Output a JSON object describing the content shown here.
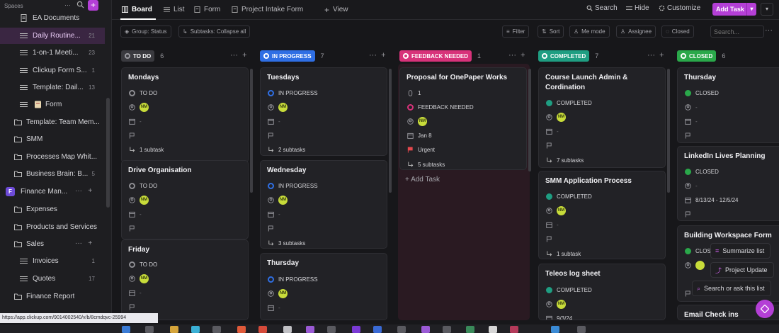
{
  "sidebar": {
    "section_label": "Spaces",
    "items": [
      {
        "label": "EA Documents",
        "count": ""
      },
      {
        "label": "Daily Routine...",
        "count": "21"
      },
      {
        "label": "1-on-1 Meeti...",
        "count": "23"
      },
      {
        "label": "Clickup Form S...",
        "count": "1"
      },
      {
        "label": "Template: Dail...",
        "count": "13"
      },
      {
        "label": "Form",
        "count": ""
      },
      {
        "label": "Template: Team Mem...",
        "count": ""
      },
      {
        "label": "SMM",
        "count": ""
      },
      {
        "label": "Processes Map Whit...",
        "count": ""
      },
      {
        "label": "Business Brain: B...",
        "count": "5"
      },
      {
        "label": "Finance Man...",
        "count": ""
      },
      {
        "label": "Expenses",
        "count": ""
      },
      {
        "label": "Products and Services",
        "count": ""
      },
      {
        "label": "Sales",
        "count": ""
      },
      {
        "label": "Invoices",
        "count": "1"
      },
      {
        "label": "Quotes",
        "count": "17"
      },
      {
        "label": "Finance Report",
        "count": ""
      }
    ],
    "finance_badge": "F"
  },
  "topbar": {
    "tabs": [
      "Board",
      "List",
      "Form",
      "Project Intake Form",
      "View"
    ],
    "search": "Search",
    "hide": "Hide",
    "customize": "Customize",
    "add_task": "Add Task"
  },
  "filterbar": {
    "group": "Group: Status",
    "subtasks": "Subtasks: Collapse all",
    "filter": "Filter",
    "sort": "Sort",
    "me_mode": "Me mode",
    "assignee": "Assignee",
    "closed": "Closed",
    "search_placeholder": "Search..."
  },
  "colors": {
    "todo": "#3a3a3f",
    "in_progress": "#2f6fe4",
    "feedback_needed": "#d8327a",
    "completed": "#1f9e82",
    "closed": "#2aa84a",
    "accent": "#b43fd6"
  },
  "columns": [
    {
      "status": "TO DO",
      "count": "6"
    },
    {
      "status": "IN PROGRESS",
      "count": "7"
    },
    {
      "status": "FEEDBACK NEEDED",
      "count": "1"
    },
    {
      "status": "COMPLETED",
      "count": "7"
    },
    {
      "status": "CLOSED",
      "count": "6"
    }
  ],
  "cards": {
    "todo": [
      {
        "title": "Mondays",
        "status": "TO DO",
        "assignee": "NM",
        "date": "-",
        "subtasks": "1 subtask"
      },
      {
        "title": "Drive Organisation",
        "status": "TO DO",
        "assignee": "NM",
        "date": "-"
      },
      {
        "title": "Friday",
        "status": "TO DO",
        "assignee": "NM",
        "date": "-"
      }
    ],
    "in_progress": [
      {
        "title": "Tuesdays",
        "status": "IN PROGRESS",
        "assignee": "NM",
        "date": "-",
        "subtasks": "2 subtasks"
      },
      {
        "title": "Wednesday",
        "status": "IN PROGRESS",
        "assignee": "NM",
        "date": "-",
        "subtasks": "3 subtasks"
      },
      {
        "title": "Thursday",
        "status": "IN PROGRESS",
        "assignee": "NM",
        "date": "-"
      }
    ],
    "feedback": [
      {
        "title": "Proposal for OnePaper Works",
        "attachments": "1",
        "status": "FEEDBACK NEEDED",
        "assignee": "NM",
        "date": "Jan 8",
        "priority": "Urgent",
        "subtasks": "5 subtasks"
      }
    ],
    "feedback_add": "Add Task",
    "completed": [
      {
        "title_1": "Course Launch Admin &",
        "title_2": "Cordination",
        "status": "COMPLETED",
        "assignee": "NM",
        "date": "-",
        "subtasks": "7 subtasks"
      },
      {
        "title": "SMM Application Process",
        "status": "COMPLETED",
        "assignee": "NM",
        "date": "-",
        "subtasks": "1 subtask"
      },
      {
        "title": "Teleos log sheet",
        "status": "COMPLETED",
        "assignee": "NM",
        "date": "9/3/24"
      }
    ],
    "closed": [
      {
        "title": "Thursday",
        "status": "CLOSED",
        "date": "-"
      },
      {
        "title": "LinkedIn Lives Planning",
        "status": "CLOSED",
        "date": "8/13/24 - 12/5/24"
      },
      {
        "title": "Building Workspace Form",
        "status": "CLOS"
      },
      {
        "title": "Email Check ins"
      }
    ]
  },
  "popups": {
    "summarize": "Summarize list",
    "project_update": "Project Update",
    "search_ask": "Search or ask this list"
  },
  "status_url": "https://app.clickup.com/9014002540/v/b/8cmdqvc-25994"
}
